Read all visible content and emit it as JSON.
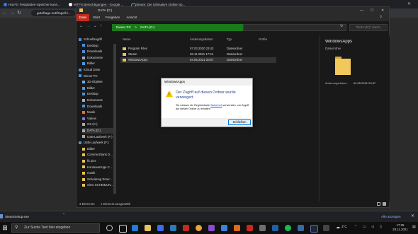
{
  "browser": {
    "tabs": [
      {
        "label": "HILFE! Festplatten-Speicher kann..."
      },
      {
        "label": "WTFS Berechtigungen - Google ..."
      },
      {
        "label": "Steam: Die Ultimative Online Sp..."
      }
    ],
    "url": "gutefrage.net/frage/hi...",
    "explorer_tab_icon_label": "DATA (D:)"
  },
  "explorer": {
    "title": "DATA (D:)",
    "ribbon_tabs": [
      "Datei",
      "Start",
      "Freigeben",
      "Ansicht"
    ],
    "address": {
      "segments": [
        "Dieser PC",
        "DATA (D:)"
      ],
      "separator": ">"
    },
    "search_placeholder": "\"DATA (D:)\" durch...",
    "sidebar": [
      {
        "label": "Schnellzugriff",
        "kind": "group"
      },
      {
        "label": "Desktop",
        "icon": "desktop-icon"
      },
      {
        "label": "Downloads",
        "icon": "download-icon"
      },
      {
        "label": "Dokumente",
        "icon": "document-icon"
      },
      {
        "label": "Bilder",
        "icon": "picture-icon"
      },
      {
        "label": "iCloud Drive",
        "kind": "group"
      },
      {
        "label": "Dieser PC",
        "kind": "group"
      },
      {
        "label": "3D-Objekte",
        "icon": "cube-icon"
      },
      {
        "label": "Bilder",
        "icon": "picture-icon"
      },
      {
        "label": "Desktop",
        "icon": "desktop-icon"
      },
      {
        "label": "Dokumente",
        "icon": "document-icon"
      },
      {
        "label": "Downloads",
        "icon": "download-icon"
      },
      {
        "label": "Musik",
        "icon": "music-icon"
      },
      {
        "label": "Videos",
        "icon": "video-icon"
      },
      {
        "label": "OS (C:)",
        "icon": "drive-icon"
      },
      {
        "label": "DATA (D:)",
        "icon": "drive-icon"
      },
      {
        "label": "USB-Laufwerk (F:)",
        "icon": "usb-icon"
      },
      {
        "label": "USB-Laufwerk (F:)",
        "kind": "group"
      },
      {
        "label": "Bilder",
        "icon": "folder-icon"
      },
      {
        "label": "Commerzbank D...",
        "icon": "folder-icon"
      },
      {
        "label": "fb pics",
        "icon": "folder-icon"
      },
      {
        "label": "Kontoauszüge C...",
        "icon": "folder-icon"
      },
      {
        "label": "musik",
        "icon": "folder-icon"
      },
      {
        "label": "Scheidung Emer...",
        "icon": "folder-icon"
      },
      {
        "label": "Sims SCHEIDUN...",
        "icon": "folder-icon"
      }
    ],
    "columns": [
      "Name",
      "Änderungsdatum",
      "Typ",
      "Größe"
    ],
    "files": [
      {
        "name": "Program Files",
        "date": "07.03.2020 23:43",
        "type": "Dateiordner",
        "size": ""
      },
      {
        "name": "Steam",
        "date": "28.11.2021 17:24",
        "type": "Dateiordner",
        "size": ""
      },
      {
        "name": "WindowsApps",
        "date": "04.05.2021 20:57",
        "type": "Dateiordner",
        "size": ""
      }
    ],
    "preview": {
      "name": "WindowsApps",
      "type": "Dateiordner",
      "date_label": "Änderungsdatum:",
      "date_value": "04.05.2021 20:57"
    },
    "status": {
      "count": "3 Elemente",
      "selected": "1 Element ausgewählt"
    }
  },
  "dialog": {
    "title": "WindowsApps",
    "main": "Der Zugriff auf diesen Ordner wurde verweigert.",
    "sub_before": "Sie müssen die Registerkarte ",
    "sub_link": "Sicherheit",
    "sub_after": " verwenden, um Zugriff auf diesen Ordner zu erhalten.",
    "button": "Schließen"
  },
  "downloads": {
    "file": "SteamSetup.exe",
    "show_all": "Alle anzeigen",
    "close": "✕"
  },
  "taskbar": {
    "search_placeholder": "Zur Suche Text hier eingeben",
    "temperature": "3°C",
    "time": "17:25",
    "date": "28.11.2021"
  },
  "colors": {
    "address_green": "#1b7a1b",
    "datei_tab": "#c42b1c",
    "folder": "#e8c25c",
    "warning": "#f5c400",
    "link": "#0a54c6"
  }
}
